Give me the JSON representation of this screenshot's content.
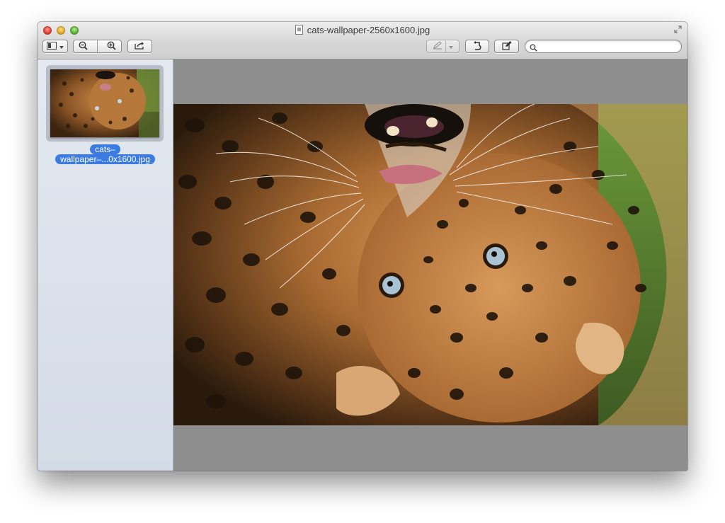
{
  "window": {
    "title": "cats-wallpaper-2560x1600.jpg",
    "file_icon": "document-icon"
  },
  "toolbar": {
    "sidebar_toggle_icon": "sidebar-icon",
    "zoom_out_icon": "zoom-out-icon",
    "zoom_in_icon": "zoom-in-icon",
    "share_icon": "share-icon",
    "markup_pen_icon": "pen-icon",
    "rotate_icon": "rotate-icon",
    "edit_icon": "edit-icon",
    "search": {
      "placeholder": "",
      "value": ""
    }
  },
  "sidebar": {
    "items": [
      {
        "label_line1": "cats–",
        "label_line2": "wallpaper–...0x1600.jpg",
        "selected": true
      }
    ]
  },
  "colors": {
    "selection": "#3b7be2",
    "canvas_bg": "#8e8e8e",
    "sidebar_bg": "#dde3eb"
  }
}
